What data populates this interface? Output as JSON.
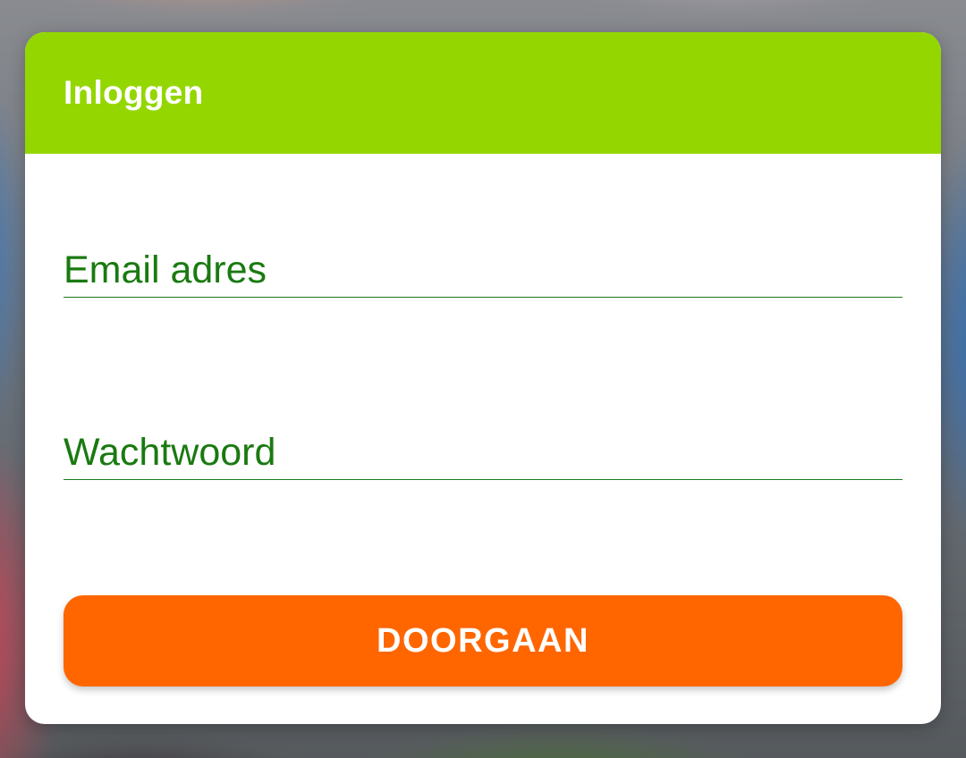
{
  "dialog": {
    "title": "Inloggen",
    "email_field": {
      "placeholder": "Email adres",
      "value": ""
    },
    "password_field": {
      "placeholder": "Wachtwoord",
      "value": ""
    },
    "submit_label": "DOORGAAN"
  },
  "colors": {
    "header": "#94d600",
    "field_text": "#1a7a10",
    "button": "#ff6600",
    "background_card": "#ffffff"
  }
}
